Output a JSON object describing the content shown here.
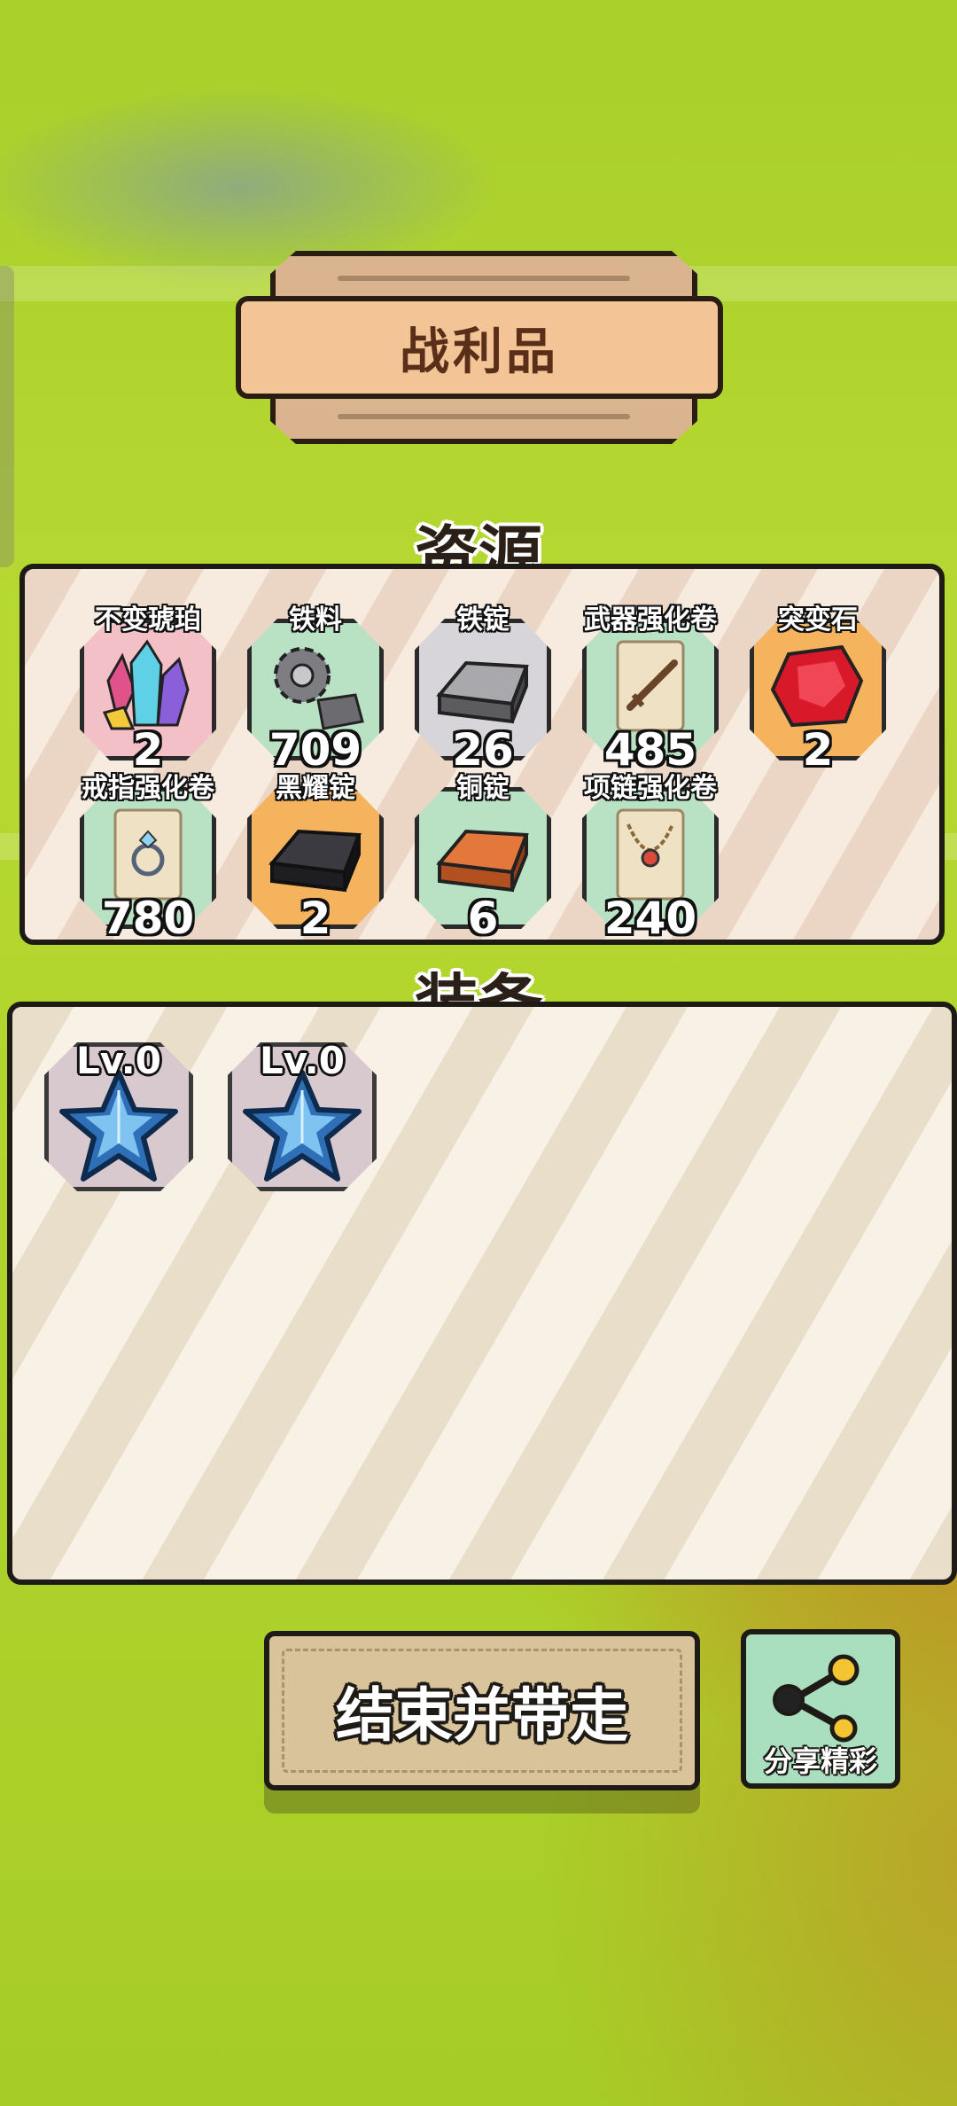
{
  "header": {
    "title": "战利品"
  },
  "resources": {
    "title": "资源",
    "items": [
      {
        "name": "不变琥珀",
        "count": "2",
        "icon": "amber-crystal-icon"
      },
      {
        "name": "铁料",
        "count": "709",
        "icon": "iron-gear-icon"
      },
      {
        "name": "铁锭",
        "count": "26",
        "icon": "iron-ingot-icon"
      },
      {
        "name": "武器强化卷",
        "count": "485",
        "icon": "weapon-scroll-icon"
      },
      {
        "name": "突变石",
        "count": "2",
        "icon": "mutation-stone-icon"
      },
      {
        "name": "戒指强化卷",
        "count": "780",
        "icon": "ring-scroll-icon"
      },
      {
        "name": "黑耀锭",
        "count": "2",
        "icon": "obsidian-ingot-icon"
      },
      {
        "name": "铜锭",
        "count": "6",
        "icon": "copper-ingot-icon"
      },
      {
        "name": "项链强化卷",
        "count": "240",
        "icon": "necklace-scroll-icon"
      }
    ]
  },
  "equipment": {
    "title": "装备",
    "items": [
      {
        "level": "Lv.0",
        "icon": "blue-star-icon"
      },
      {
        "level": "Lv.0",
        "icon": "blue-star-icon"
      }
    ]
  },
  "actions": {
    "end_label": "结束并带走",
    "share_label": "分享精彩"
  }
}
